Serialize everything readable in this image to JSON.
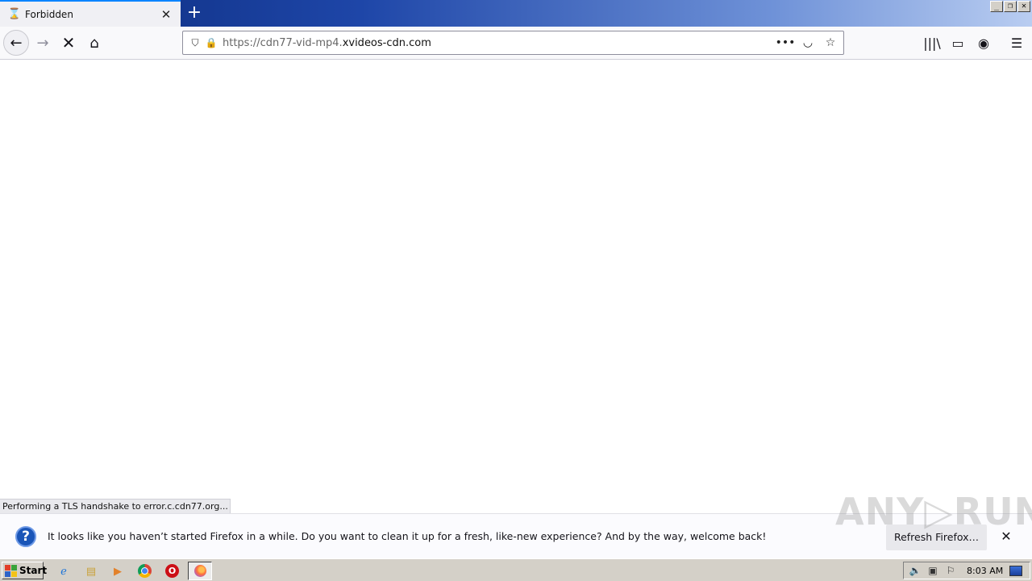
{
  "browser": {
    "tab": {
      "title": "Forbidden",
      "icon": "hourglass-icon"
    },
    "new_tab_label": "+",
    "window_buttons": {
      "minimize": "_",
      "restore": "❐",
      "close": "✕"
    },
    "nav": {
      "back_icon": "←",
      "forward_icon": "→",
      "stop_icon": "✕",
      "home_icon": "⌂"
    },
    "url": {
      "prefix": "https://cdn77-vid-mp4.",
      "domain": "xvideos-cdn.com"
    },
    "url_actions": {
      "more": "•••",
      "pocket": "◡",
      "bookmark": "☆"
    },
    "toolbar_right": {
      "library": "|||\\",
      "sidebar": "▭",
      "account": "◉",
      "menu": "☰"
    },
    "accent_color": "#0a84ff"
  },
  "status": {
    "text": "Performing a TLS handshake to error.c.cdn77.org..."
  },
  "notification": {
    "icon": "?",
    "message": "It looks like you haven’t started Firefox in a while. Do you want to clean it up for a fresh, like-new experience? And by the way, welcome back!",
    "button_label": "Refresh Firefox…",
    "close_label": "✕"
  },
  "watermark": {
    "text": "ANY▷RUN"
  },
  "taskbar": {
    "start_label": "Start",
    "clock": "8:03 AM",
    "quicklaunch": [
      "ie-icon",
      "explorer-icon",
      "media-player-icon",
      "chrome-icon",
      "opera-icon",
      "firefox-icon"
    ],
    "tray": {
      "volume": "🔈",
      "network": "▣",
      "flag": "⚐"
    }
  }
}
